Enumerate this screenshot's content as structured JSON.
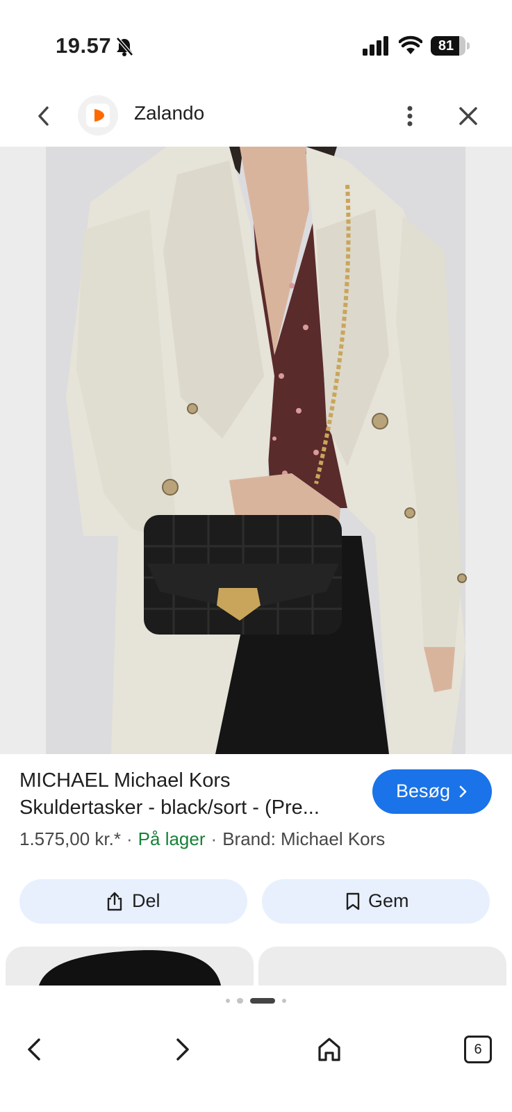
{
  "status_bar": {
    "time": "19.57",
    "battery_level": "81",
    "battery_percent": 81
  },
  "top_bar": {
    "site_name": "Zalando",
    "brand_color": "#ff6900"
  },
  "product": {
    "title_line1": "MICHAEL Michael Kors",
    "title_line2": "Skuldertasker - black/sort - (Pre...",
    "price": "1.575,00 kr.*",
    "separator": "·",
    "stock": "På lager",
    "brand": "Brand: Michael Kors",
    "visit_label": "Besøg"
  },
  "actions": {
    "share_label": "Del",
    "save_label": "Gem"
  },
  "pager": {
    "count": 4,
    "active_index": 2
  },
  "bottom_nav": {
    "tabs_count": "6"
  },
  "colors": {
    "accent": "#1a73e8",
    "stock_green": "#188038",
    "action_bg": "#e8f0fe"
  }
}
